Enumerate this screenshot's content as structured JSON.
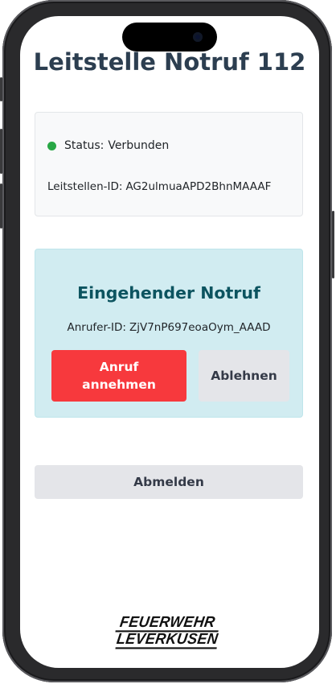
{
  "page": {
    "title": "Leitstelle Notruf 112"
  },
  "status": {
    "label": "Status:",
    "value": "Verbunden",
    "color": "#28a745"
  },
  "station": {
    "label": "Leitstellen-ID:",
    "id": "AG2ulmuaAPD2BhnMAAAF"
  },
  "incoming_call": {
    "title": "Eingehender Notruf",
    "caller_label": "Anrufer-ID:",
    "caller_id": "ZjV7nP697eoaOym_AAAD",
    "accept_label": "Anruf annehmen",
    "decline_label": "Ablehnen"
  },
  "logout_label": "Abmelden",
  "logo": {
    "line1": "FEUERWEHR",
    "line2": "LEVERKUSEN"
  },
  "colors": {
    "accent_danger": "#f7393d",
    "info_background": "#d1ecf1",
    "title_color": "#2c3e50"
  }
}
